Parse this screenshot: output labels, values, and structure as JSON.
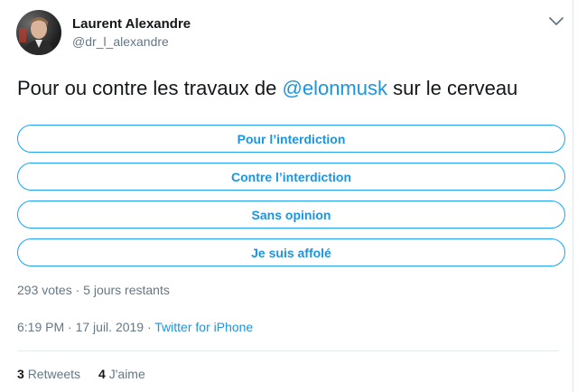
{
  "author": {
    "display_name": "Laurent Alexandre",
    "handle": "@dr_l_alexandre"
  },
  "tweet": {
    "text_before": "Pour ou contre les travaux de ",
    "mention": "@elonmusk",
    "text_after": " sur le cerveau"
  },
  "poll": {
    "options": [
      {
        "label": "Pour l’interdiction"
      },
      {
        "label": "Contre l’interdiction"
      },
      {
        "label": "Sans opinion"
      },
      {
        "label": "Je suis affolé"
      }
    ],
    "meta": "293 votes · 5 jours restants"
  },
  "timestamp": {
    "time_date": "6:19 PM · 17 juil. 2019 · ",
    "source": "Twitter for iPhone"
  },
  "stats": {
    "retweets_count": "3",
    "retweets_label": "Retweets",
    "likes_count": "4",
    "likes_label": "J'aime"
  },
  "colors": {
    "accent": "#1da1f2",
    "link": "#1b95e0",
    "secondary_text": "#657786"
  },
  "icons": {
    "menu": "chevron-down-icon",
    "avatar": "avatar"
  }
}
